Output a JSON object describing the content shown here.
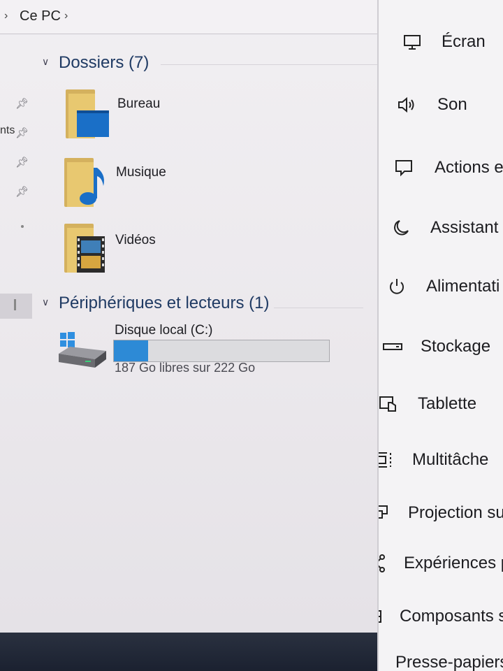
{
  "address_bar": {
    "location": "Ce PC"
  },
  "quick_access": {
    "partial_text": "nts"
  },
  "groups": {
    "folders": {
      "title": "Dossiers (7)"
    },
    "drives": {
      "title": "Périphériques et lecteurs (1)"
    }
  },
  "folders": [
    {
      "label": "Bureau",
      "icon": "desktop-folder-icon"
    },
    {
      "label": "Musique",
      "icon": "music-folder-icon"
    },
    {
      "label": "Vidéos",
      "icon": "videos-folder-icon"
    }
  ],
  "drive": {
    "name": "Disque local (C:)",
    "free_text": "187 Go libres sur 222 Go",
    "free_gb": 187,
    "total_gb": 222,
    "bar_color": "#2d8ad6"
  },
  "settings_nav": [
    {
      "label": "Écran",
      "icon": "monitor-icon"
    },
    {
      "label": "Son",
      "icon": "speaker-icon"
    },
    {
      "label": "Actions e",
      "icon": "notification-icon"
    },
    {
      "label": "Assistant",
      "icon": "moon-icon"
    },
    {
      "label": "Alimentati",
      "icon": "power-icon"
    },
    {
      "label": "Stockage",
      "icon": "storage-icon"
    },
    {
      "label": "Tablette",
      "icon": "tablet-icon"
    },
    {
      "label": "Multitâche",
      "icon": "multitask-icon"
    },
    {
      "label": "Projection su",
      "icon": "projection-icon"
    },
    {
      "label": "Expériences p",
      "icon": "shared-experiences-icon"
    },
    {
      "label": "Composants sy",
      "icon": "components-icon"
    },
    {
      "label": "Presse-papiers",
      "icon": "clipboard-icon"
    }
  ]
}
